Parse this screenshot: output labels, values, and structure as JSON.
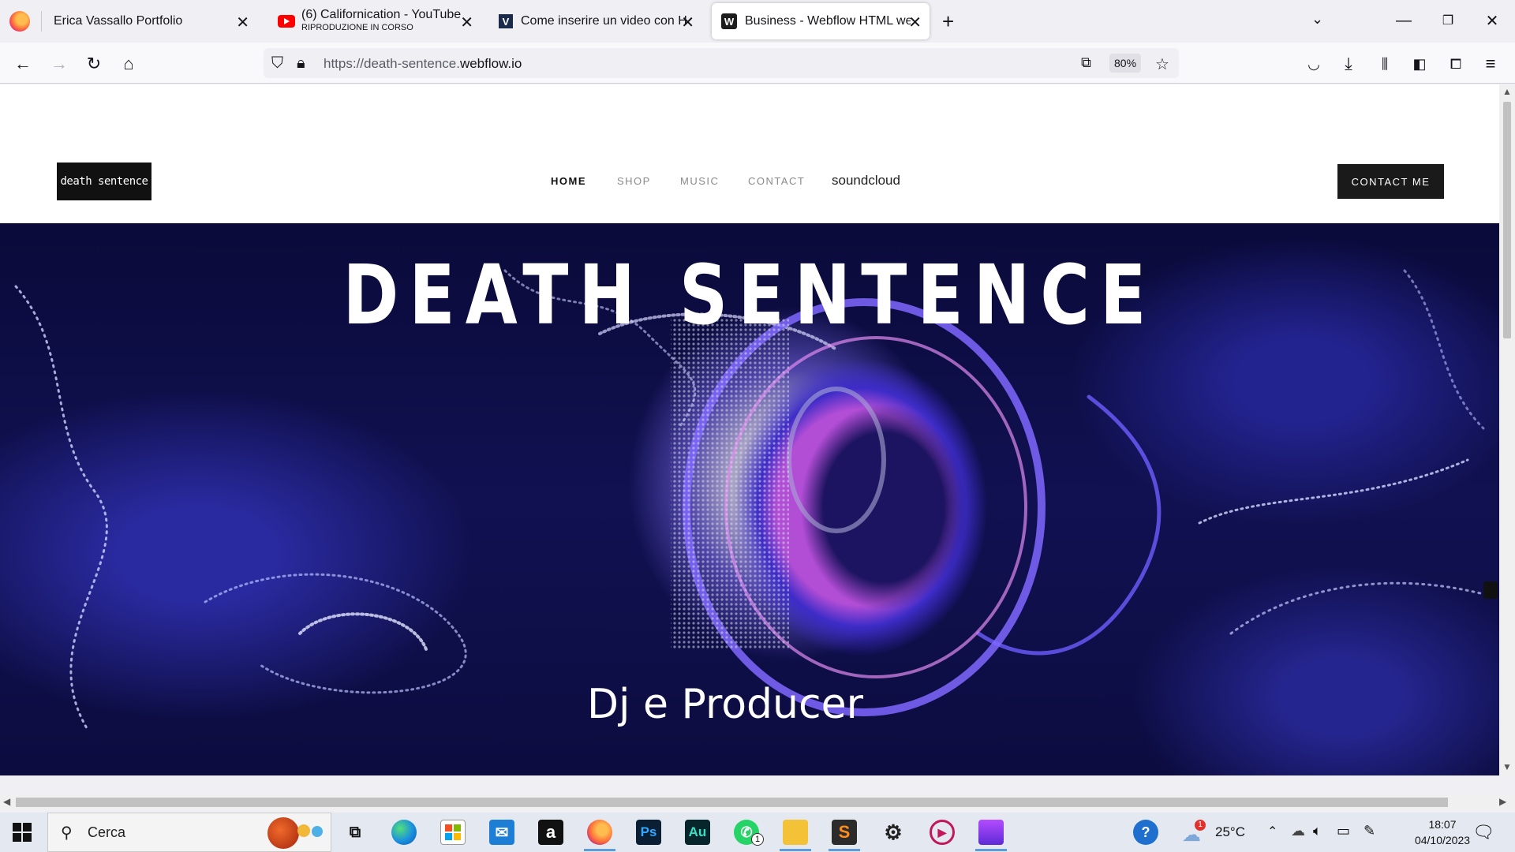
{
  "browser": {
    "tabs": [
      {
        "title": "Erica Vassallo Portfolio",
        "subtitle": "",
        "icon": "firefox-icon"
      },
      {
        "title": "(6) Californication - YouTube",
        "subtitle": "RIPRODUZIONE IN CORSO",
        "icon": "youtube-icon"
      },
      {
        "title": "Come inserire un video con HTM",
        "subtitle": "",
        "icon": "v-site-icon"
      },
      {
        "title": "Business - Webflow HTML webs",
        "subtitle": "",
        "icon": "webflow-icon"
      }
    ],
    "new_tab_label": "+",
    "url_prefix": "https://death-sentence.",
    "url_domain": "webflow.io",
    "zoom": "80%"
  },
  "site": {
    "logo_text": "death sentence",
    "nav": [
      {
        "label": "HOME",
        "active": true
      },
      {
        "label": "SHOP",
        "active": false
      },
      {
        "label": "MUSIC",
        "active": false
      },
      {
        "label": "CONTACT",
        "active": false
      }
    ],
    "nav_soundcloud": "soundcloud",
    "contact_button": "CONTACT ME",
    "hero_title": "DEATH SENTENCE",
    "hero_subtitle": "Dj e Producer"
  },
  "taskbar": {
    "search_placeholder": "Cerca",
    "temperature": "25°C",
    "weather_badge": "1",
    "time": "18:07",
    "date": "04/10/2023",
    "whatsapp_badge": "1",
    "photoshop_label": "Ps",
    "audition_label": "Au",
    "amazon_label": "a"
  },
  "colors": {
    "accent": "#5d9cdc",
    "hero_dark": "#0c0c40",
    "hero_purple": "#b24dd6"
  }
}
